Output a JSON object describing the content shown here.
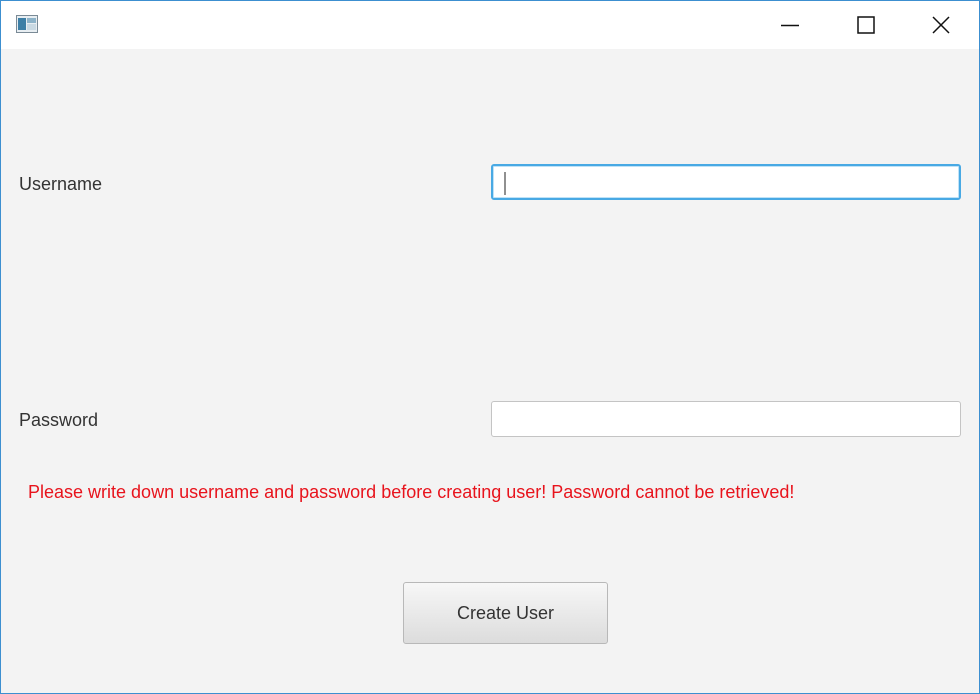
{
  "window": {
    "title": "",
    "icons": {
      "app": "app-window-icon",
      "minimize": "minimize-icon",
      "maximize": "maximize-icon",
      "close": "close-icon"
    },
    "accent_border": "#3c8fd0"
  },
  "form": {
    "username_label": "Username",
    "username_value": "",
    "password_label": "Password",
    "password_value": "",
    "warning": "Please write down username and password before creating user! Password cannot be retrieved!",
    "warning_color": "#e8131c",
    "focus_color": "#48a9e4"
  },
  "actions": {
    "create_user_label": "Create User"
  }
}
